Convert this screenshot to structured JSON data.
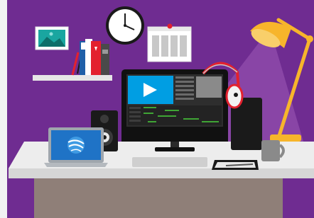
{
  "scene": {
    "description_visible_text": [],
    "colors": {
      "wall": "#6f2c91",
      "wall_stripe": "#f2f2f2",
      "desk_top": "#ededed",
      "desk_front": "#bfbfbf",
      "desk_base": "#8f7f78",
      "monitor_frame": "#111111",
      "screen_blue": "#009ee3",
      "lamp_yellow": "#f7b52b",
      "speaker_black": "#1a1a1a",
      "headphones_red": "#e3212e",
      "laptop_gray": "#9fa6ad",
      "laptop_screen": "#1f73c6",
      "mug_gray": "#8a8a8a",
      "frame_teal": "#1aa6a0"
    },
    "icons": {
      "play": "play-icon",
      "clock": "clock-icon",
      "calendar": "calendar-icon",
      "picture": "picture-frame-icon",
      "lamp": "desk-lamp-icon",
      "laptop_logo": "globe-logo-icon"
    }
  }
}
